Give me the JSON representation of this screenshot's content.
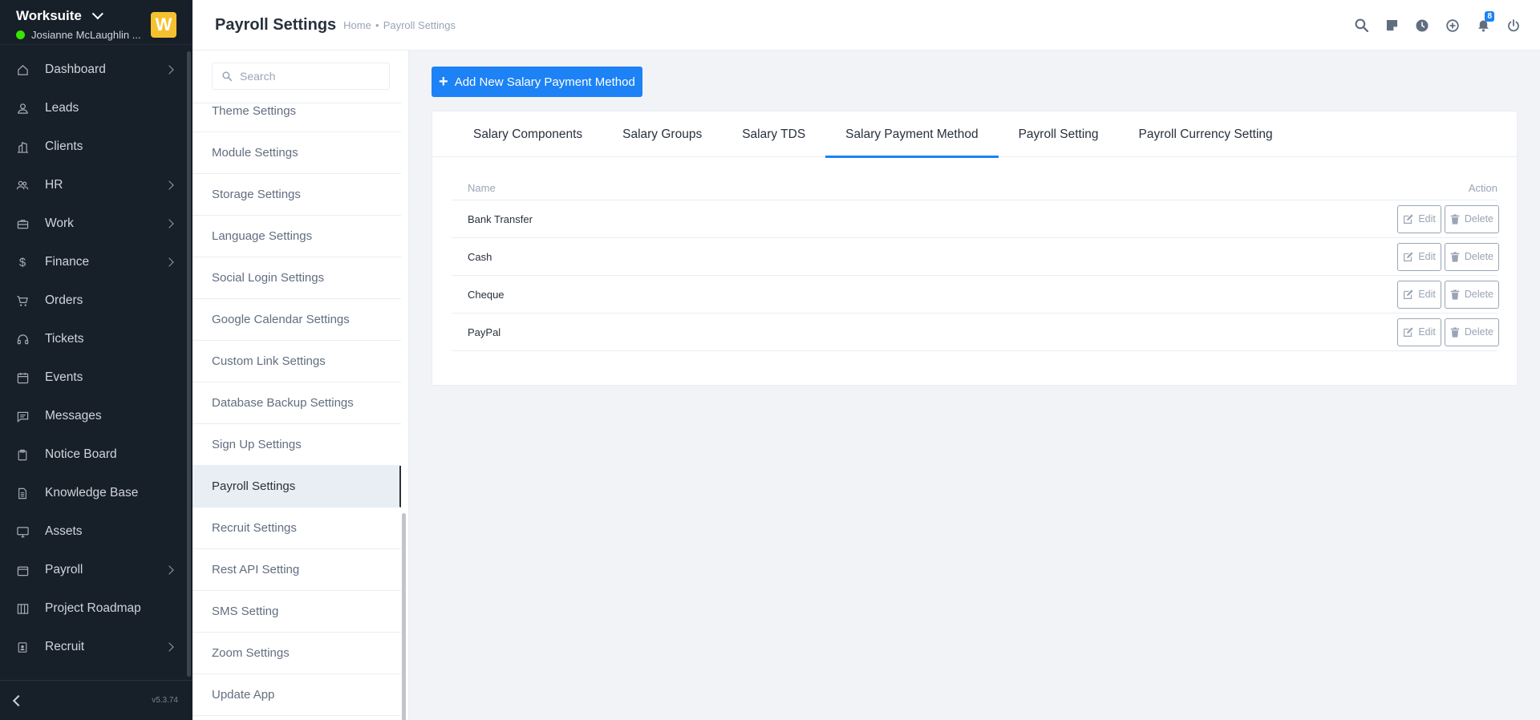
{
  "sidebar": {
    "company": "Worksuite",
    "user": "Josianne McLaughlin ...",
    "logo_letter": "W",
    "version": "v5.3.74",
    "items": [
      {
        "label": "Dashboard",
        "icon": "house-icon",
        "arrow": true
      },
      {
        "label": "Leads",
        "icon": "person-icon",
        "arrow": false
      },
      {
        "label": "Clients",
        "icon": "building-icon",
        "arrow": false
      },
      {
        "label": "HR",
        "icon": "people-icon",
        "arrow": true
      },
      {
        "label": "Work",
        "icon": "briefcase-icon",
        "arrow": true
      },
      {
        "label": "Finance",
        "icon": "dollar-icon",
        "arrow": true
      },
      {
        "label": "Orders",
        "icon": "cart-icon",
        "arrow": false
      },
      {
        "label": "Tickets",
        "icon": "headset-icon",
        "arrow": false
      },
      {
        "label": "Events",
        "icon": "calendar-icon",
        "arrow": false
      },
      {
        "label": "Messages",
        "icon": "chat-icon",
        "arrow": false
      },
      {
        "label": "Notice Board",
        "icon": "clipboard-icon",
        "arrow": false
      },
      {
        "label": "Knowledge Base",
        "icon": "document-icon",
        "arrow": false
      },
      {
        "label": "Assets",
        "icon": "monitor-icon",
        "arrow": false
      },
      {
        "label": "Payroll",
        "icon": "wallet-icon",
        "arrow": true
      },
      {
        "label": "Project Roadmap",
        "icon": "columns-icon",
        "arrow": false
      },
      {
        "label": "Recruit",
        "icon": "badge-icon",
        "arrow": true
      }
    ]
  },
  "header": {
    "title": "Payroll Settings",
    "breadcrumb": [
      "Home",
      "Payroll Settings"
    ],
    "notification_count": "8"
  },
  "settings_menu": {
    "search_placeholder": "Search",
    "items": [
      {
        "label": "Theme Settings",
        "active": false
      },
      {
        "label": "Module Settings",
        "active": false
      },
      {
        "label": "Storage Settings",
        "active": false
      },
      {
        "label": "Language Settings",
        "active": false
      },
      {
        "label": "Social Login Settings",
        "active": false
      },
      {
        "label": "Google Calendar Settings",
        "active": false
      },
      {
        "label": "Custom Link Settings",
        "active": false
      },
      {
        "label": "Database Backup Settings",
        "active": false
      },
      {
        "label": "Sign Up Settings",
        "active": false
      },
      {
        "label": "Payroll Settings",
        "active": true
      },
      {
        "label": "Recruit Settings",
        "active": false
      },
      {
        "label": "Rest API Setting",
        "active": false
      },
      {
        "label": "SMS Setting",
        "active": false
      },
      {
        "label": "Zoom Settings",
        "active": false
      },
      {
        "label": "Update App",
        "active": false
      }
    ]
  },
  "main": {
    "add_button_label": "Add New Salary Payment Method",
    "tabs": [
      {
        "label": "Salary Components",
        "active": false
      },
      {
        "label": "Salary Groups",
        "active": false
      },
      {
        "label": "Salary TDS",
        "active": false
      },
      {
        "label": "Salary Payment Method",
        "active": true
      },
      {
        "label": "Payroll Setting",
        "active": false
      },
      {
        "label": "Payroll Currency Setting",
        "active": false
      }
    ],
    "table": {
      "columns": [
        "Name",
        "Action"
      ],
      "edit_label": "Edit",
      "delete_label": "Delete",
      "rows": [
        "Bank Transfer",
        "Cash",
        "Cheque",
        "PayPal"
      ]
    }
  },
  "colors": {
    "sidebar_bg": "#171f29",
    "accent": "#1d82f5",
    "online": "#39e500",
    "logo_bg": "#f6c12f"
  }
}
